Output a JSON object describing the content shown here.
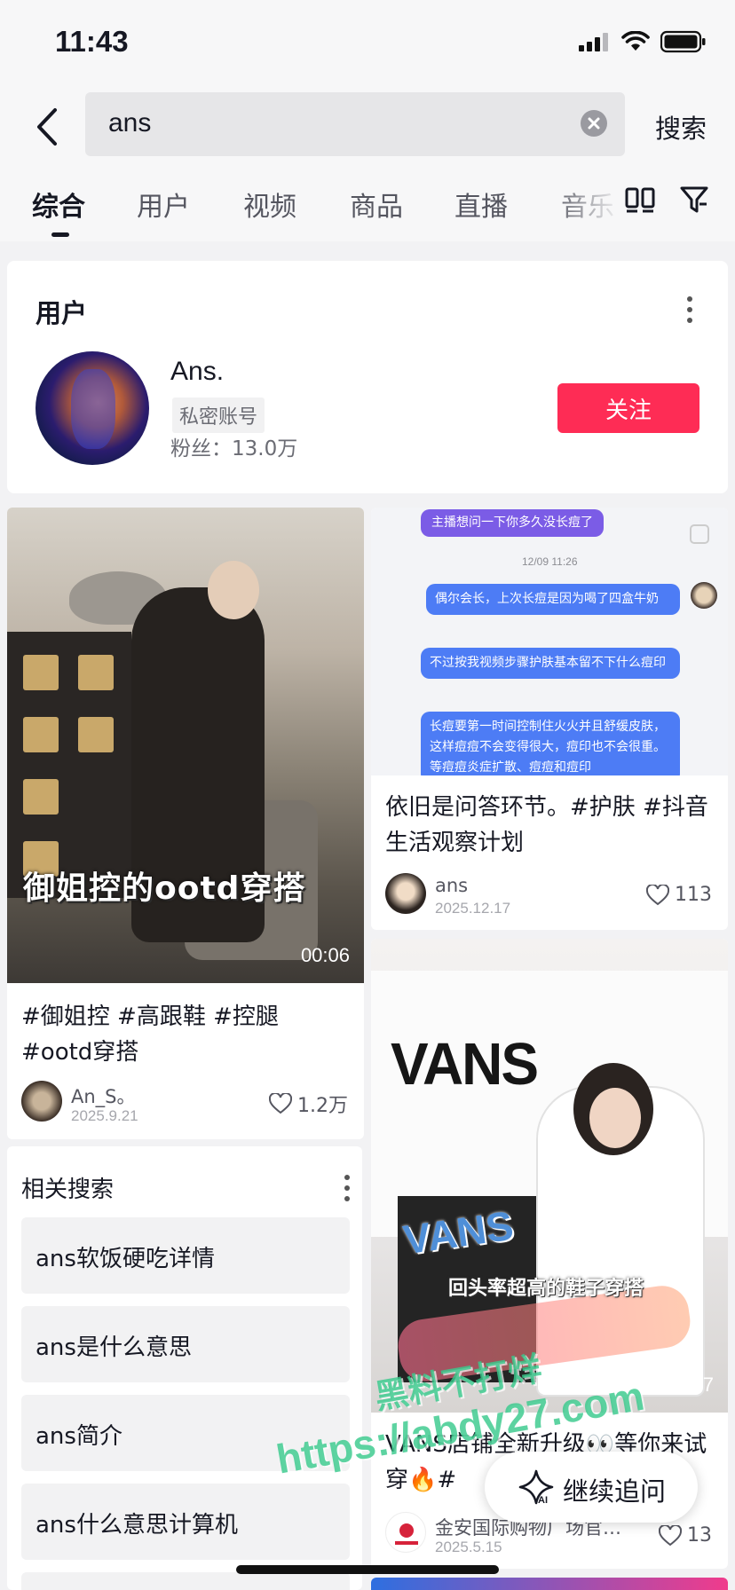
{
  "status_bar": {
    "time": "11:43"
  },
  "search": {
    "query": "ans",
    "submit_label": "搜索"
  },
  "tabs": [
    {
      "label": "综合",
      "active": true
    },
    {
      "label": "用户",
      "active": false
    },
    {
      "label": "视频",
      "active": false
    },
    {
      "label": "商品",
      "active": false
    },
    {
      "label": "直播",
      "active": false
    },
    {
      "label": "音乐",
      "active": false
    }
  ],
  "user_section": {
    "title": "用户",
    "user": {
      "name": "Ans.",
      "tag": "私密账号",
      "fans": "粉丝：13.0万",
      "follow_label": "关注"
    }
  },
  "feed": [
    {
      "cover_caption": "御姐控的ootd穿搭",
      "duration": "00:06",
      "description": "#御姐控 #高跟鞋 #控腿 #ootd穿搭",
      "author": "An_S。",
      "date": "2025.9.21",
      "likes": "1.2万"
    },
    {
      "cover": {
        "top_bubble": "主播想问一下你多久没长痘了",
        "time": "12/09 11:26",
        "bubbles": [
          "偶尔会长，上次长痘是因为喝了四盒牛奶",
          "不过按我视频步骤护肤基本留不下什么痘印",
          "长痘要第一时间控制住火火并且舒缓皮肤，这样痘痘不会变得很大，痘印也不会很重。等痘痘炎症扩散、痘痘和痘印"
        ]
      },
      "description": "依旧是问答环节。#护肤 #抖音生活观察计划",
      "author": "ans",
      "date": "2025.12.17",
      "likes": "113"
    },
    {
      "cover": {
        "brand": "VANS",
        "sticker": "VANS",
        "caption": "回头率超高的鞋子穿搭"
      },
      "duration": "00:37",
      "description": "VANS店铺全新升级👀等你来试穿🔥#",
      "author": "金安国际购物广场官…",
      "date": "2025.5.15",
      "likes": "13"
    }
  ],
  "related_searches": {
    "title": "相关搜索",
    "items": [
      "ans软饭硬吃详情",
      "ans是什么意思",
      "ans简介",
      "ans什么意思计算机"
    ]
  },
  "watermark": {
    "line1": "黑料不打烊",
    "line2": "https://abdy27.com"
  },
  "followup": {
    "label": "继续追问",
    "icon_text": "AI"
  },
  "colors": {
    "accent": "#fe2c55",
    "watermark": "#39c98c",
    "chat_blue": "#4d7cf5",
    "chat_purple": "#7b5ce6"
  }
}
